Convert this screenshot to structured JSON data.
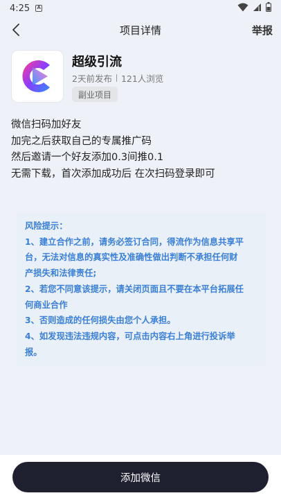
{
  "status_bar": {
    "time": "4:25",
    "notify_glyph": "A",
    "icons": [
      "wifi-icon",
      "signal-icon",
      "battery-icon"
    ]
  },
  "nav": {
    "title": "项目详情",
    "report_label": "举报",
    "back_icon": "chevron-left-icon"
  },
  "project": {
    "name": "超级引流",
    "published": "2天前发布",
    "views": "121人浏览",
    "tag": "副业项目",
    "logo_icon": "play-c-logo",
    "logo_colors": [
      "#ff3d8b",
      "#8b3dff",
      "#2f8cff"
    ]
  },
  "description": [
    "微信扫码加好友",
    "加完之后获取自己的专属推广码",
    "然后邀请一个好友添加0.3间推0.1",
    "无需下载，首次添加成功后 在次扫码登录即可"
  ],
  "risk": {
    "title": "风险提示：",
    "lines": [
      "1、建立合作之前，请务必签订合同，得流作为信息共享平",
      "台，无法对信息的真实性及准确性做出判断不承担任何财",
      "产损失和法律责任;",
      "2、若您不同意该提示，请关闭页面且不要在本平台拓展任",
      "何商业合作",
      "3、否则造成的任何损失由您个人承担。",
      "4、如发现违法违规内容，可点击内容右上角进行投诉举",
      "报。"
    ],
    "color": "#3a7fd6"
  },
  "action": {
    "add_wechat_label": "添加微信",
    "button_color": "#1e2030"
  }
}
